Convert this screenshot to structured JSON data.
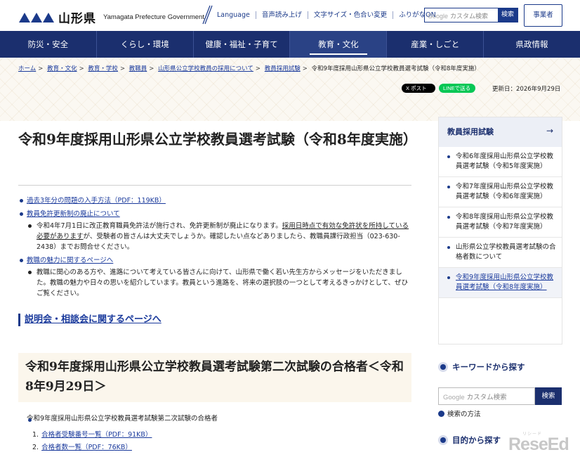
{
  "header": {
    "logo_ja": "山形県",
    "logo_en": "Yamagata Prefecture Government",
    "util_links": [
      "Language",
      "音声読み上げ",
      "文字サイズ・色合い変更",
      "ふりがなON"
    ],
    "search_google": "Google",
    "search_placeholder": "カスタム検索",
    "search_button": "検索",
    "business_button": "事業者"
  },
  "nav": [
    "防災・安全",
    "くらし・環境",
    "健康・福祉・子育て",
    "教育・文化",
    "産業・しごと",
    "県政情報"
  ],
  "nav_active_index": 3,
  "breadcrumb": [
    "ホーム",
    "教育・文化",
    "教育・学校",
    "教職員",
    "山形県公立学校教員の採用について",
    "教員採用試験",
    "令和9年度採用山形県公立学校教員選考試験（令和8年度実施）"
  ],
  "share": {
    "x": "X ポスト",
    "line": "LINEで送る"
  },
  "updated": "更新日：2026年9月29日",
  "main": {
    "title": "令和9年度採用山形県公立学校教員選考試験（令和8年度実施）",
    "items": [
      {
        "link": "過去3年分の問題の入手方法（PDF：119KB）"
      },
      {
        "link": "教員免許更新制の廃止について",
        "sub_a": "令和4年7月1日に改正教育職員免許法が施行され、免許更新制が廃止になります。",
        "sub_u": "採用日時点で有効な免許状を所持している必要があります",
        "sub_b": "が、受験者の皆さんは大丈夫でしょうか。確認したい点などありましたら、教職員課行政担当（023-630-2438）までお問合せください。"
      },
      {
        "link": "教職の魅力に関するページへ",
        "sub": "教職に関心のある方や、進路について考えている皆さんに向けて、山形県で働く若い先生方からメッセージをいただきました。教職の魅力や日々の思いを紹介しています。教員という進路を、将来の選択肢の一つとして考えるきっかけとして、ぜひご覧ください。"
      }
    ],
    "info_session_link": "説明会・相談会に関するページへ",
    "section_title": "令和9年度採用山形県公立学校教員選考試験第二次試験の合格者＜令和8年9月29日＞",
    "section_text": "令和9年度採用山形県公立学校教員選考試験第二次試験の合格者",
    "section_links": [
      {
        "num": "1.",
        "label": "合格者受験番号一覧（PDF：91KB）"
      },
      {
        "num": "2.",
        "label": "合格者数一覧（PDF：76KB）"
      }
    ]
  },
  "sidebar": {
    "title": "教員採用試験",
    "arrow": "→",
    "items": [
      "令和6年度採用山形県公立学校教員選考試験（令和5年度実施）",
      "令和7年度採用山形県公立学校教員選考試験（令和6年度実施）",
      "令和8年度採用山形県公立学校教員選考試験（令和7年度実施）",
      "山形県公立学校教員選考試験の合格者数について",
      "令和9年度採用山形県公立学校教員選考試験（令和8年度実施）"
    ],
    "keyword_title": "キーワードから探す",
    "search_google": "Google",
    "search_placeholder": "カスタム検索",
    "search_button": "検索",
    "search_howto": "検索の方法",
    "purpose_title": "目的から探す"
  },
  "watermark": {
    "main": "ReseEd",
    "small": "リシード"
  }
}
